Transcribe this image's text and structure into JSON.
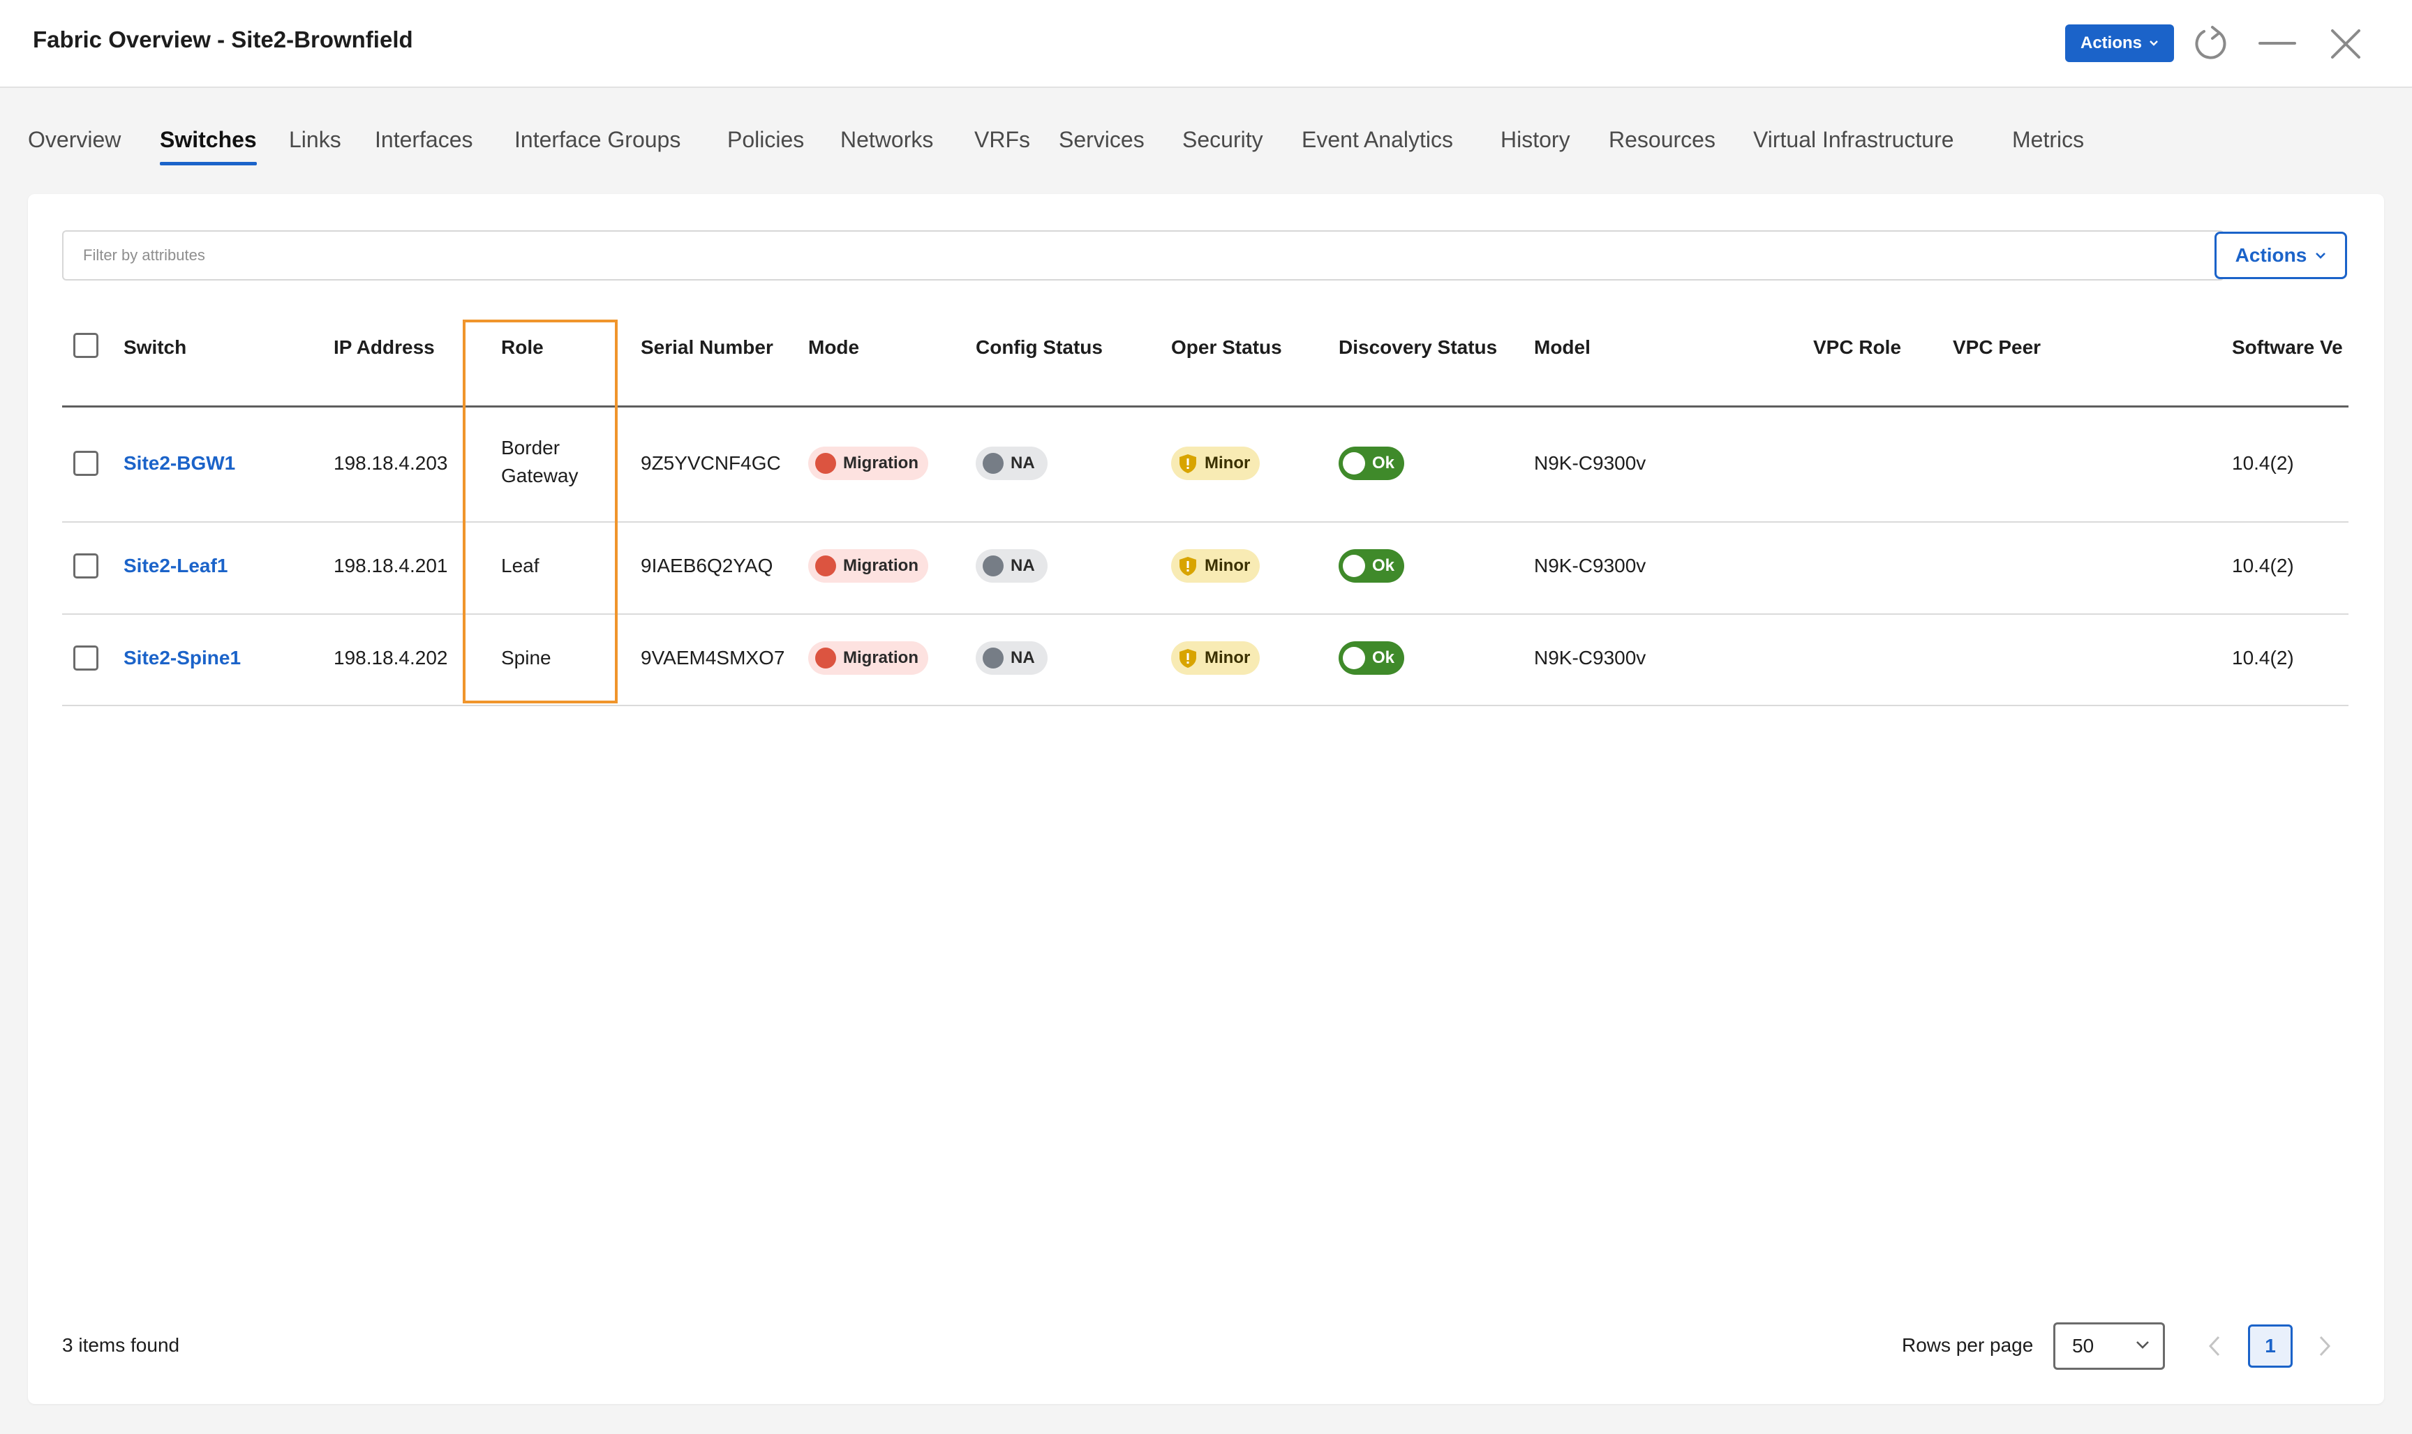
{
  "window": {
    "title": "Fabric Overview - Site2-Brownfield",
    "actions_label": "Actions"
  },
  "tabs": [
    {
      "label": "Overview"
    },
    {
      "label": "Switches",
      "active": true
    },
    {
      "label": "Links"
    },
    {
      "label": "Interfaces"
    },
    {
      "label": "Interface Groups"
    },
    {
      "label": "Policies"
    },
    {
      "label": "Networks"
    },
    {
      "label": "VRFs"
    },
    {
      "label": "Services"
    },
    {
      "label": "Security"
    },
    {
      "label": "Event Analytics"
    },
    {
      "label": "History"
    },
    {
      "label": "Resources"
    },
    {
      "label": "Virtual Infrastructure"
    },
    {
      "label": "Metrics"
    }
  ],
  "toolbar": {
    "filter_placeholder": "Filter by attributes",
    "actions_label": "Actions"
  },
  "table": {
    "columns": [
      "Switch",
      "IP Address",
      "Role",
      "Serial Number",
      "Mode",
      "Config Status",
      "Oper Status",
      "Discovery Status",
      "Model",
      "VPC Role",
      "VPC Peer",
      "Software Ve"
    ],
    "rows": [
      {
        "switch": "Site2-BGW1",
        "ip": "198.18.4.203",
        "role": "Border Gateway",
        "serial": "9Z5YVCNF4GC",
        "mode": "Migration",
        "config_status": "NA",
        "oper_status": "Minor",
        "discovery_status": "Ok",
        "model": "N9K-C9300v",
        "vpc_role": "",
        "vpc_peer": "",
        "software": "10.4(2)"
      },
      {
        "switch": "Site2-Leaf1",
        "ip": "198.18.4.201",
        "role": "Leaf",
        "serial": "9IAEB6Q2YAQ",
        "mode": "Migration",
        "config_status": "NA",
        "oper_status": "Minor",
        "discovery_status": "Ok",
        "model": "N9K-C9300v",
        "vpc_role": "",
        "vpc_peer": "",
        "software": "10.4(2)"
      },
      {
        "switch": "Site2-Spine1",
        "ip": "198.18.4.202",
        "role": "Spine",
        "serial": "9VAEM4SMXO7",
        "mode": "Migration",
        "config_status": "NA",
        "oper_status": "Minor",
        "discovery_status": "Ok",
        "model": "N9K-C9300v",
        "vpc_role": "",
        "vpc_peer": "",
        "software": "10.4(2)"
      }
    ]
  },
  "footer": {
    "items_found": "3 items found",
    "rows_per_page_label": "Rows per page",
    "rows_per_page_value": "50",
    "current_page": "1"
  },
  "colors": {
    "accent": "#1b63c9",
    "highlight": "#f0952c",
    "migration": "#dc5440",
    "ok": "#3f8a2a",
    "minor": "#f8ebb4"
  }
}
